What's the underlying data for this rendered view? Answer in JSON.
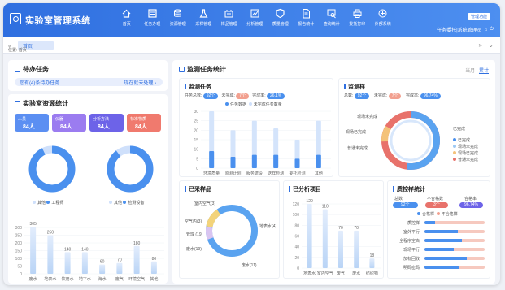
{
  "app": {
    "title": "实验室管理系统",
    "mgmt_label": "管理功能",
    "user_label": "任务委托|系统管理员"
  },
  "nav": [
    {
      "label": "首页",
      "icon": "home-icon"
    },
    {
      "label": "任务办理",
      "icon": "task-icon"
    },
    {
      "label": "资源管理",
      "icon": "database-icon"
    },
    {
      "label": "采样管理",
      "icon": "flask-icon"
    },
    {
      "label": "样品管理",
      "icon": "sample-icon"
    },
    {
      "label": "分析管理",
      "icon": "chart-icon"
    },
    {
      "label": "质量管理",
      "icon": "shield-icon"
    },
    {
      "label": "报告统计",
      "icon": "report-icon"
    },
    {
      "label": "查询统计",
      "icon": "query-icon"
    },
    {
      "label": "委托打印",
      "icon": "printer-icon"
    },
    {
      "label": "外部系统",
      "icon": "external-icon"
    }
  ],
  "tabs": {
    "home": "首页"
  },
  "breadcrumb": "位置: 首页",
  "todo": {
    "title": "待办任务",
    "notice": "您有(4)条待办任务",
    "action": "现在就去处理 ›"
  },
  "resource": {
    "title": "实验室资源统计",
    "cards": [
      {
        "label": "人员",
        "value": "84人",
        "color": "#5b8ff2"
      },
      {
        "label": "仪器",
        "value": "84人",
        "color": "#9b7cf0"
      },
      {
        "label": "分析方法",
        "value": "84人",
        "color": "#6d63e8"
      },
      {
        "label": "标准物质",
        "value": "84人",
        "color": "#f07a6e"
      }
    ],
    "donut1_legend": [
      "其他",
      "工程师"
    ],
    "donut2_legend": [
      "其他",
      "检测设备"
    ]
  },
  "monitor": {
    "title": "监测任务统计",
    "range_month": "当月",
    "range_total": "累计",
    "task": {
      "title": "监测任务",
      "total_label": "任务总数:",
      "total": "92个",
      "unfinished_label": "未完成:",
      "unfinished": "7个",
      "rate_label": "完成率:",
      "rate": "26.1%",
      "legend_done": "任务数据",
      "legend_undone": "未完成任务数量"
    },
    "sample": {
      "title": "监测样",
      "total_label": "总数:",
      "total": "92个",
      "unfinished_label": "未完成:",
      "unfinished": "7个",
      "rate_label": "完成率:",
      "rate": "96.74%",
      "labels": [
        "现场未完成",
        "现场已完成",
        "普通未完成",
        "已完成"
      ],
      "legend": [
        "已完成",
        "现场未完成",
        "现场已完成",
        "普通未完成"
      ]
    },
    "collected": {
      "title": "已采样品",
      "labels": [
        "室内空气(3)",
        "空气内(3)",
        "管理\n(19)",
        "废水(19)",
        "地表水(4)",
        "废水(11)"
      ]
    },
    "analysis": {
      "title": "已分析项目"
    },
    "quality": {
      "title": "质控样统计",
      "h_total": "总数",
      "h_bad": "不合格数",
      "h_rate": "合格率",
      "total": "92个",
      "bad": "3个",
      "rate": "96.74%",
      "leg_ok": "合格样",
      "leg_bad": "不合格样",
      "rows": [
        "质控样",
        "室外平行",
        "全程序空白",
        "现场平行",
        "加标回收",
        "明码密码"
      ]
    }
  },
  "chart_data": [
    {
      "type": "bar",
      "title": "监测任务",
      "categories": [
        "环境质量",
        "监测计划",
        "服务建设",
        "送样检测",
        "委托检测",
        "其他"
      ],
      "series": [
        {
          "name": "任务数据",
          "values": [
            30,
            20,
            25,
            21,
            15,
            25
          ]
        },
        {
          "name": "未完成任务数量",
          "values": [
            9,
            6,
            7,
            7,
            5,
            7
          ]
        }
      ],
      "ylim": [
        0,
        30
      ]
    },
    {
      "type": "bar",
      "title": "样品类型",
      "categories": [
        "废水",
        "地表水",
        "饮用水",
        "地下水",
        "海水",
        "废气",
        "环境空气",
        "其他"
      ],
      "values": [
        305,
        250,
        140,
        140,
        60,
        70,
        180,
        80
      ],
      "ylim": [
        0,
        300
      ]
    },
    {
      "type": "bar",
      "title": "已分析项目",
      "categories": [
        "地表水",
        "室内空气",
        "废气",
        "废水",
        "纺织物"
      ],
      "values": [
        120,
        110,
        70,
        70,
        18
      ],
      "ylim": [
        0,
        120
      ]
    },
    {
      "type": "pie",
      "title": "已采样品",
      "categories": [
        "室内空气",
        "地表水",
        "管理",
        "废水"
      ],
      "values": [
        3,
        3,
        19,
        19
      ]
    }
  ]
}
